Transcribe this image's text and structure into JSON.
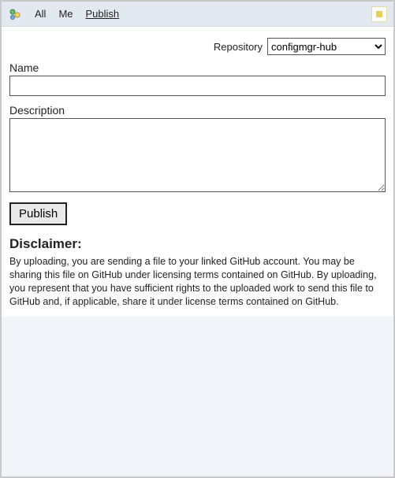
{
  "toolbar": {
    "tabs": [
      {
        "label": "All"
      },
      {
        "label": "Me"
      },
      {
        "label": "Publish"
      }
    ],
    "active_tab_index": 2
  },
  "form": {
    "repository_label": "Repository",
    "repository_selected": "configmgr-hub",
    "name_label": "Name",
    "name_value": "",
    "description_label": "Description",
    "description_value": "",
    "publish_button": "Publish"
  },
  "disclaimer": {
    "heading": "Disclaimer:",
    "text": "By uploading, you are sending a file to your linked GitHub account. You may be sharing this file on GitHub under licensing terms contained on GitHub. By uploading, you represent that you have sufficient rights to the uploaded work to send this file to GitHub and, if applicable, share it under license terms contained on GitHub."
  }
}
